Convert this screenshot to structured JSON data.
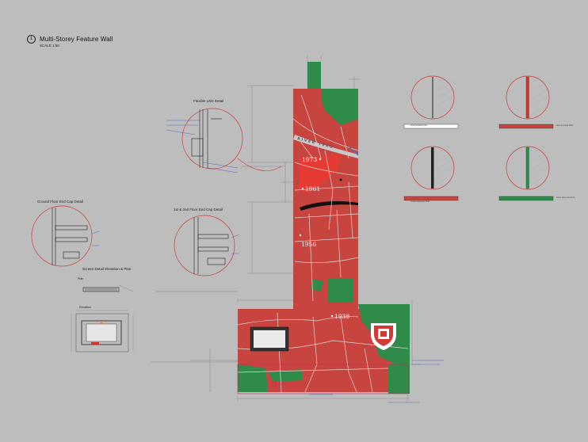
{
  "drawing": {
    "number": "1",
    "title": "Multi-Storey Feature Wall",
    "scale": "SCALE 1:50"
  },
  "details": {
    "flexible_led": "Flexible LED Detail",
    "ground_floor_end_cap": "Ground Floor End Cap Detail",
    "upper_floor_end_cap": "1st & 2nd Floor End Cap Detail",
    "screen_detail": "Screen Detail Elevation & Plan",
    "plan": "Plan",
    "elevation": "Elevation"
  },
  "map": {
    "river_label": "RIVER TEES",
    "years": [
      "1973",
      "1961",
      "1956",
      "1938"
    ]
  },
  "colors": {
    "background": "#bdbdbd",
    "map_red": "#c8443f",
    "map_green": "#2e8b4a",
    "roads": "#e6d6d6",
    "annotation_blue": "#3355cc",
    "highlight_magenta": "#cc2266"
  },
  "legend": [
    {
      "swatch": "#ffffff",
      "note": "Clear laminate finish"
    },
    {
      "swatch": "#c8443f",
      "note": "Red vinyl wrap finish"
    },
    {
      "swatch": "#c8443f",
      "note": "Printed wall panel finish"
    },
    {
      "swatch": "#2e8b4a",
      "note": "Green vinyl wrap finish"
    }
  ]
}
